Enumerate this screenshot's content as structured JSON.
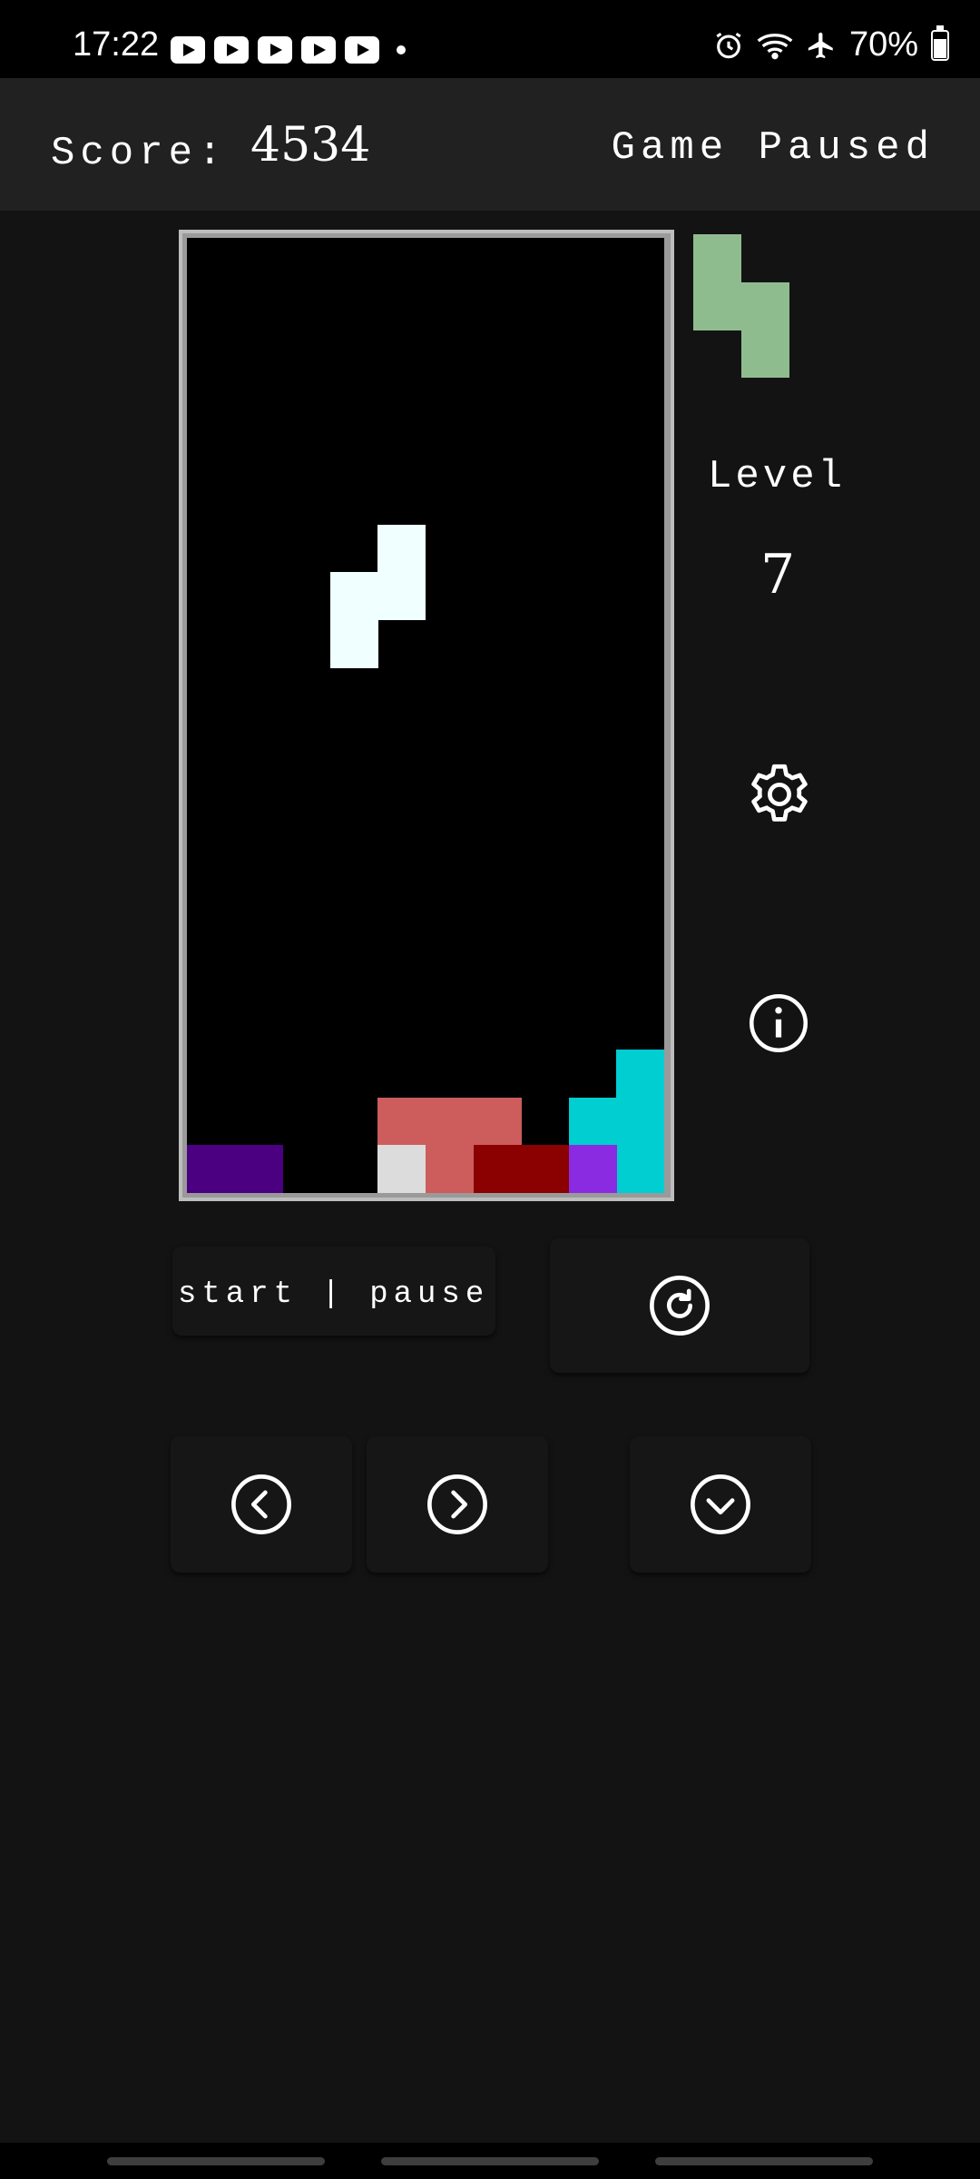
{
  "status_bar": {
    "time": "17:22",
    "notification_icons": [
      "youtube-icon",
      "youtube-icon",
      "youtube-icon",
      "youtube-icon",
      "youtube-icon"
    ],
    "right_icons": [
      "alarm-icon",
      "wifi-icon",
      "airplane-icon"
    ],
    "battery": "70%",
    "battery_level": 0.7
  },
  "header": {
    "score_label": "Score:",
    "score_value": "4534",
    "game_status": "Game Paused"
  },
  "colors": {
    "background": "#131313",
    "header": "#212121",
    "board": "#000000",
    "board_border": "#bdbdbd",
    "active_piece": "#f0ffff",
    "next_piece": "#8fbc8f",
    "salmon": "#cd5c5c",
    "dark_red": "#8b0000",
    "indigo": "#4b0082",
    "violet": "#8a2be2",
    "cyan": "#00ced1",
    "light_gray": "#dcdcdc"
  },
  "board": {
    "columns": 10,
    "rows": 20,
    "active_piece": {
      "color": "#f0ffff",
      "cells": [
        [
          4,
          6
        ],
        [
          4,
          7
        ],
        [
          3,
          7
        ],
        [
          3,
          8
        ]
      ]
    },
    "locked_cells": [
      {
        "col": 9,
        "row": 17,
        "color": "#00ced1"
      },
      {
        "col": 8,
        "row": 18,
        "color": "#00ced1"
      },
      {
        "col": 9,
        "row": 18,
        "color": "#00ced1"
      },
      {
        "col": 9,
        "row": 19,
        "color": "#00ced1"
      },
      {
        "col": 8,
        "row": 19,
        "color": "#8a2be2"
      },
      {
        "col": 4,
        "row": 18,
        "color": "#cd5c5c"
      },
      {
        "col": 5,
        "row": 18,
        "color": "#cd5c5c"
      },
      {
        "col": 6,
        "row": 18,
        "color": "#cd5c5c"
      },
      {
        "col": 5,
        "row": 19,
        "color": "#cd5c5c"
      },
      {
        "col": 4,
        "row": 19,
        "color": "#dcdcdc"
      },
      {
        "col": 6,
        "row": 19,
        "color": "#8b0000"
      },
      {
        "col": 7,
        "row": 19,
        "color": "#8b0000"
      },
      {
        "col": 0,
        "row": 19,
        "color": "#4b0082"
      },
      {
        "col": 1,
        "row": 19,
        "color": "#4b0082"
      }
    ]
  },
  "next_piece": {
    "color": "#8fbc8f",
    "cells": [
      [
        0,
        0
      ],
      [
        0,
        1
      ],
      [
        1,
        1
      ],
      [
        1,
        2
      ]
    ]
  },
  "side_panel": {
    "level_label": "Level",
    "level_value": "7",
    "settings_icon": "gear-icon",
    "info_icon": "info-icon"
  },
  "controls": {
    "start_pause_label": "start | pause",
    "rotate_icon": "rotate-icon",
    "left_icon": "chevron-left-icon",
    "right_icon": "chevron-right-icon",
    "down_icon": "chevron-down-icon"
  }
}
